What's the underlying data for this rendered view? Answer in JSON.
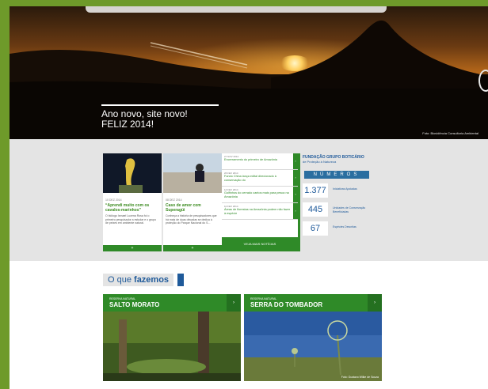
{
  "colors": {
    "frame": "#6e9a2a",
    "brand_green": "#2f8a28",
    "brand_blue": "#1f5a9a",
    "band": "#e4e4e4"
  },
  "hero": {
    "title": "Ano novo, site novo!",
    "subtitle": "FELIZ 2014!",
    "credit": "Foto: Biovidência Consultoria Ambiental",
    "next_icon": "chevron-right-icon"
  },
  "news_cards": [
    {
      "date": "10 DEZ 2014",
      "title": "“Aprendi muito com os cavalos-marinhos”",
      "text": "O biólogo Ismael Lucena Rosa foi o primeiro pesquisador a estudar e o grupo de peixes em ambiente natural.",
      "more": "+"
    },
    {
      "date": "08 DEZ 2014",
      "title": "Caso de amor com Superagüi",
      "text": "Conheça a história de pesquisadores que há mais de duas décadas se dedica à proteção do Parque Nacional do S...",
      "more": "+"
    }
  ],
  "news_list": [
    {
      "date": "27 NOV 2014",
      "title": "Encerramento do primeiro de Amazônia",
      "arrow": "›"
    },
    {
      "date": "26 FEV 2014",
      "title": "Fundo China lança edital direcionado à conservação do",
      "arrow": "›"
    },
    {
      "date": "14 FEV 2014",
      "title": "Golfinhos do cerrado cantos mais para pesca na Amazônia",
      "arrow": "›"
    },
    {
      "date": "10 FEV 2014",
      "title": "Áreas de florestas na Amazônia podem não fazer à espécie",
      "arrow": "›"
    }
  ],
  "news_all_label": "VEJA MAIS NOTÍCIAS",
  "stats": {
    "title": "FUNDAÇÃO GRUPO BOTICÁRIO",
    "subtitle": "de Proteção à Natureza",
    "button": "NÚMEROS",
    "items": [
      {
        "value": "1.377",
        "label": "Iniciativas Apoiadas"
      },
      {
        "value": "445",
        "label": "Unidades de Conservação Beneficiadas"
      },
      {
        "value": "67",
        "label": "Espécies Descritas"
      }
    ]
  },
  "section": {
    "prefix": "O que",
    "bold": "fazemos"
  },
  "places": [
    {
      "kicker": "RESERVA NATURAL",
      "name": "SALTO MORATO",
      "arrow": "›",
      "credit": ""
    },
    {
      "kicker": "RESERVA NATURAL",
      "name": "SERRA DO TOMBADOR",
      "arrow": "›",
      "credit": "Foto: Gustavo Wilke de Souza"
    }
  ]
}
